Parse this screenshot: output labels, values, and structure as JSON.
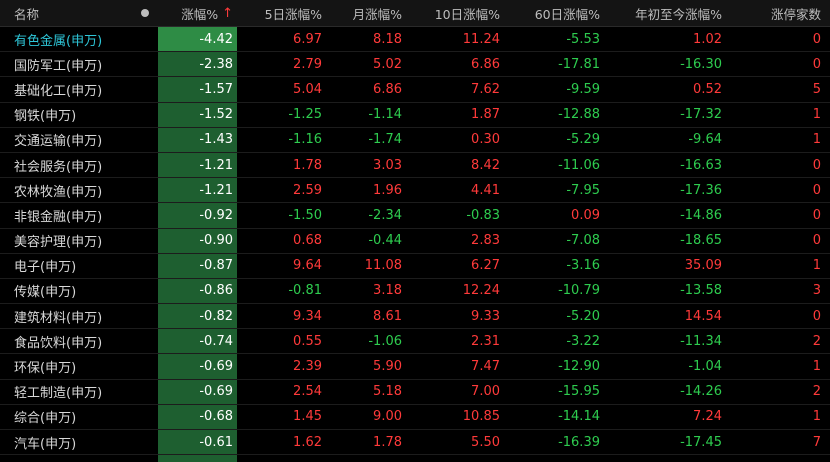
{
  "header": {
    "name": "名称",
    "change_pct": "涨幅%",
    "sort_arrow": "↑",
    "chg_5d": "5日涨幅%",
    "chg_month": "月涨幅%",
    "chg_10d": "10日涨幅%",
    "chg_60d": "60日涨幅%",
    "chg_ytd": "年初至今涨幅%",
    "limit_up_count": "涨停家数"
  },
  "colors": {
    "up": "#ff3a3a",
    "down": "#2ecc4f",
    "active_name": "#2ec6d8",
    "change_column_bg": "#1e5f30"
  },
  "rows": [
    {
      "name": "有色金属(申万)",
      "chg": "-4.42",
      "d5": "6.97",
      "mon": "8.18",
      "d10": "11.24",
      "d60": "-5.53",
      "ytd": "1.02",
      "lim": "0"
    },
    {
      "name": "国防军工(申万)",
      "chg": "-2.38",
      "d5": "2.79",
      "mon": "5.02",
      "d10": "6.86",
      "d60": "-17.81",
      "ytd": "-16.30",
      "lim": "0"
    },
    {
      "name": "基础化工(申万)",
      "chg": "-1.57",
      "d5": "5.04",
      "mon": "6.86",
      "d10": "7.62",
      "d60": "-9.59",
      "ytd": "0.52",
      "lim": "5"
    },
    {
      "name": "钢铁(申万)",
      "chg": "-1.52",
      "d5": "-1.25",
      "mon": "-1.14",
      "d10": "1.87",
      "d60": "-12.88",
      "ytd": "-17.32",
      "lim": "1"
    },
    {
      "name": "交通运输(申万)",
      "chg": "-1.43",
      "d5": "-1.16",
      "mon": "-1.74",
      "d10": "0.30",
      "d60": "-5.29",
      "ytd": "-9.64",
      "lim": "1"
    },
    {
      "name": "社会服务(申万)",
      "chg": "-1.21",
      "d5": "1.78",
      "mon": "3.03",
      "d10": "8.42",
      "d60": "-11.06",
      "ytd": "-16.63",
      "lim": "0"
    },
    {
      "name": "农林牧渔(申万)",
      "chg": "-1.21",
      "d5": "2.59",
      "mon": "1.96",
      "d10": "4.41",
      "d60": "-7.95",
      "ytd": "-17.36",
      "lim": "0"
    },
    {
      "name": "非银金融(申万)",
      "chg": "-0.92",
      "d5": "-1.50",
      "mon": "-2.34",
      "d10": "-0.83",
      "d60": "0.09",
      "ytd": "-14.86",
      "lim": "0"
    },
    {
      "name": "美容护理(申万)",
      "chg": "-0.90",
      "d5": "0.68",
      "mon": "-0.44",
      "d10": "2.83",
      "d60": "-7.08",
      "ytd": "-18.65",
      "lim": "0"
    },
    {
      "name": "电子(申万)",
      "chg": "-0.87",
      "d5": "9.64",
      "mon": "11.08",
      "d10": "6.27",
      "d60": "-3.16",
      "ytd": "35.09",
      "lim": "1"
    },
    {
      "name": "传媒(申万)",
      "chg": "-0.86",
      "d5": "-0.81",
      "mon": "3.18",
      "d10": "12.24",
      "d60": "-10.79",
      "ytd": "-13.58",
      "lim": "3"
    },
    {
      "name": "建筑材料(申万)",
      "chg": "-0.82",
      "d5": "9.34",
      "mon": "8.61",
      "d10": "9.33",
      "d60": "-5.20",
      "ytd": "14.54",
      "lim": "0"
    },
    {
      "name": "食品饮料(申万)",
      "chg": "-0.74",
      "d5": "0.55",
      "mon": "-1.06",
      "d10": "2.31",
      "d60": "-3.22",
      "ytd": "-11.34",
      "lim": "2"
    },
    {
      "name": "环保(申万)",
      "chg": "-0.69",
      "d5": "2.39",
      "mon": "5.90",
      "d10": "7.47",
      "d60": "-12.90",
      "ytd": "-1.04",
      "lim": "1"
    },
    {
      "name": "轻工制造(申万)",
      "chg": "-0.69",
      "d5": "2.54",
      "mon": "5.18",
      "d10": "7.00",
      "d60": "-15.95",
      "ytd": "-14.26",
      "lim": "2"
    },
    {
      "name": "综合(申万)",
      "chg": "-0.68",
      "d5": "1.45",
      "mon": "9.00",
      "d10": "10.85",
      "d60": "-14.14",
      "ytd": "7.24",
      "lim": "1"
    },
    {
      "name": "汽车(申万)",
      "chg": "-0.61",
      "d5": "1.62",
      "mon": "1.78",
      "d10": "5.50",
      "d60": "-16.39",
      "ytd": "-17.45",
      "lim": "7"
    }
  ]
}
